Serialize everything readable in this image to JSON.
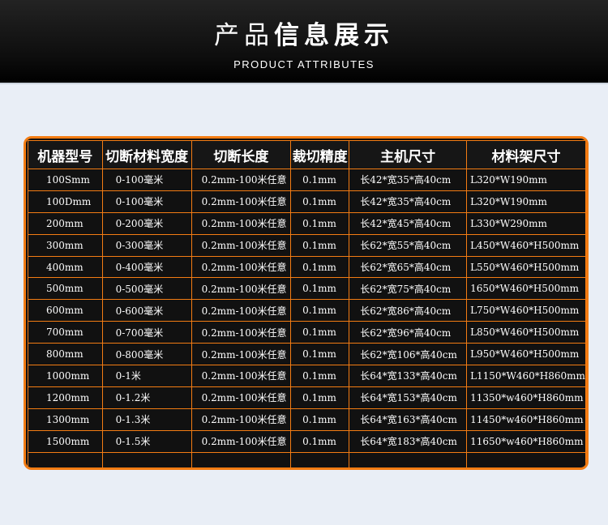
{
  "header": {
    "title_light": "产品",
    "title_bold": "信息展示",
    "subtitle": "PRODUCT ATTRIBUTES"
  },
  "table": {
    "columns": [
      "机器型号",
      "切断材料宽度",
      "切断长度",
      "裁切精度",
      "主机尺寸",
      "材料架尺寸"
    ],
    "rows": [
      [
        "100Smm",
        "0-100毫米",
        "0.2mm-100米任意",
        "0.1mm",
        "长42*宽35*高40cm",
        "L320*W190mm"
      ],
      [
        "100Dmm",
        "0-100毫米",
        "0.2mm-100米任意",
        "0.1mm",
        "长42*宽35*高40cm",
        "L320*W190mm"
      ],
      [
        "200mm",
        "0-200毫米",
        "0.2mm-100米任意",
        "0.1mm",
        "长42*宽45*高40cm",
        "L330*W290mm"
      ],
      [
        "300mm",
        "0-300毫米",
        "0.2mm-100米任意",
        "0.1mm",
        "长62*宽55*高40cm",
        "L450*W460*H500mm"
      ],
      [
        "400mm",
        "0-400毫米",
        "0.2mm-100米任意",
        "0.1mm",
        "长62*宽65*高40cm",
        "L550*W460*H500mm"
      ],
      [
        "500mm",
        "0-500毫米",
        "0.2mm-100米任意",
        "0.1mm",
        "长62*宽75*高40cm",
        "1650*W460*H500mm"
      ],
      [
        "600mm",
        "0-600毫米",
        "0.2mm-100米任意",
        "0.1mm",
        "长62*宽86*高40cm",
        "L750*W460*H500mm"
      ],
      [
        "700mm",
        "0-700毫米",
        "0.2mm-100米任意",
        "0.1mm",
        "长62*宽96*高40cm",
        "L850*W460*H500mm"
      ],
      [
        "800mm",
        "0-800毫米",
        "0.2mm-100米任意",
        "0.1mm",
        "长62*宽106*高40cm",
        "L950*W460*H500mm"
      ],
      [
        "1000mm",
        "0-1米",
        "0.2mm-100米任意",
        "0.1mm",
        "长64*宽133*高40cm",
        "L1150*W460*H860mm"
      ],
      [
        "1200mm",
        "0-1.2米",
        "0.2mm-100米任意",
        "0.1mm",
        "长64*宽153*高40cm",
        "11350*w460*H860mm"
      ],
      [
        "1300mm",
        "0-1.3米",
        "0.2mm-100米任意",
        "0.1mm",
        "长64*宽163*高40cm",
        "11450*w460*H860mm"
      ],
      [
        "1500mm",
        "0-1.5米",
        "0.2mm-100米任意",
        "0.1mm",
        "长64*宽183*高40cm",
        "11650*w460*H860mm"
      ]
    ]
  },
  "colors": {
    "accent": "#f37c13",
    "table_bg": "#111111",
    "header_bg": "#0d0d0d",
    "page_bg": "#e9eef6"
  }
}
